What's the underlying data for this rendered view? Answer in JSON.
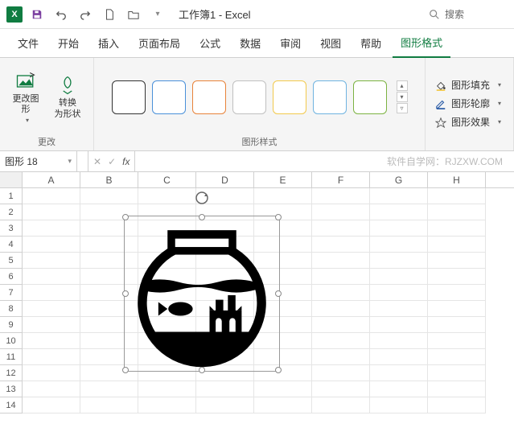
{
  "titlebar": {
    "app_abbrev": "X",
    "doc_title": "工作簿1 - Excel",
    "search_placeholder": "搜索"
  },
  "tabs": {
    "items": [
      {
        "id": "file",
        "label": "文件"
      },
      {
        "id": "home",
        "label": "开始"
      },
      {
        "id": "insert",
        "label": "插入"
      },
      {
        "id": "layout",
        "label": "页面布局"
      },
      {
        "id": "formulas",
        "label": "公式"
      },
      {
        "id": "data",
        "label": "数据"
      },
      {
        "id": "review",
        "label": "审阅"
      },
      {
        "id": "view",
        "label": "视图"
      },
      {
        "id": "help",
        "label": "帮助"
      },
      {
        "id": "shapefmt",
        "label": "图形格式"
      }
    ],
    "active": "shapefmt"
  },
  "ribbon": {
    "group_change": {
      "label": "更改",
      "change_graphic": "更改图\n形",
      "convert_shape": "转换\n为形状"
    },
    "group_styles": {
      "label": "图形样式"
    },
    "shape_options": {
      "fill": "图形填充",
      "outline": "图形轮廓",
      "effects": "图形效果"
    }
  },
  "namebox": {
    "value": "图形 18"
  },
  "fx": {
    "label": "fx"
  },
  "watermark": "软件自学网：RJZXW.COM",
  "columns": [
    "A",
    "B",
    "C",
    "D",
    "E",
    "F",
    "G",
    "H"
  ],
  "rows": [
    "1",
    "2",
    "3",
    "4",
    "5",
    "6",
    "7",
    "8",
    "9",
    "10",
    "11",
    "12",
    "13",
    "14"
  ],
  "shape": {
    "name": "fishbowl-icon"
  }
}
